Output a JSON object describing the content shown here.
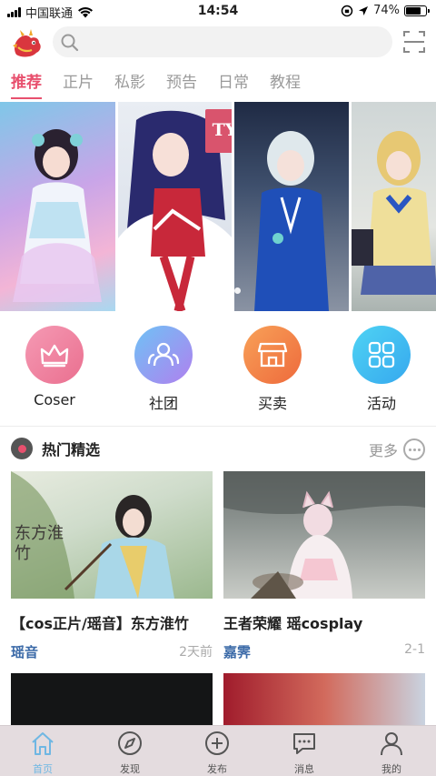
{
  "status_bar": {
    "carrier": "中国联通",
    "time": "14:54",
    "battery": "74%"
  },
  "header": {
    "search_placeholder": ""
  },
  "tabs": [
    {
      "label": "推荐",
      "active": true
    },
    {
      "label": "正片",
      "active": false
    },
    {
      "label": "私影",
      "active": false
    },
    {
      "label": "预告",
      "active": false
    },
    {
      "label": "日常",
      "active": false
    },
    {
      "label": "教程",
      "active": false
    }
  ],
  "banner": {
    "badge_text": "TYA"
  },
  "categories": [
    {
      "label": "Coser",
      "icon": "crown-icon",
      "color": "#ef7a9a"
    },
    {
      "label": "社团",
      "icon": "group-icon",
      "color": "#9a8cf2"
    },
    {
      "label": "买卖",
      "icon": "shop-icon",
      "color": "#f07a45"
    },
    {
      "label": "活动",
      "icon": "grid-icon",
      "color": "#3fc3f0"
    }
  ],
  "hot": {
    "title": "热门精选",
    "more": "更多",
    "cards": [
      {
        "title": "【cos正片/瑶音】东方淮竹",
        "author": "瑶音",
        "date": "2天前",
        "caption": "东方淮竹"
      },
      {
        "title": "王者荣耀 瑶cosplay",
        "author": "嘉霁",
        "date": "2-1"
      }
    ]
  },
  "tabbar": [
    {
      "label": "首页",
      "icon": "home-icon",
      "active": true
    },
    {
      "label": "发现",
      "icon": "compass-icon",
      "active": false
    },
    {
      "label": "发布",
      "icon": "plus-circle-icon",
      "active": false
    },
    {
      "label": "消息",
      "icon": "message-icon",
      "active": false
    },
    {
      "label": "我的",
      "icon": "user-icon",
      "active": false
    }
  ],
  "colors": {
    "accent": "#e8506e",
    "author": "#3b6aa8",
    "tab_active": "#6fb7e3"
  }
}
